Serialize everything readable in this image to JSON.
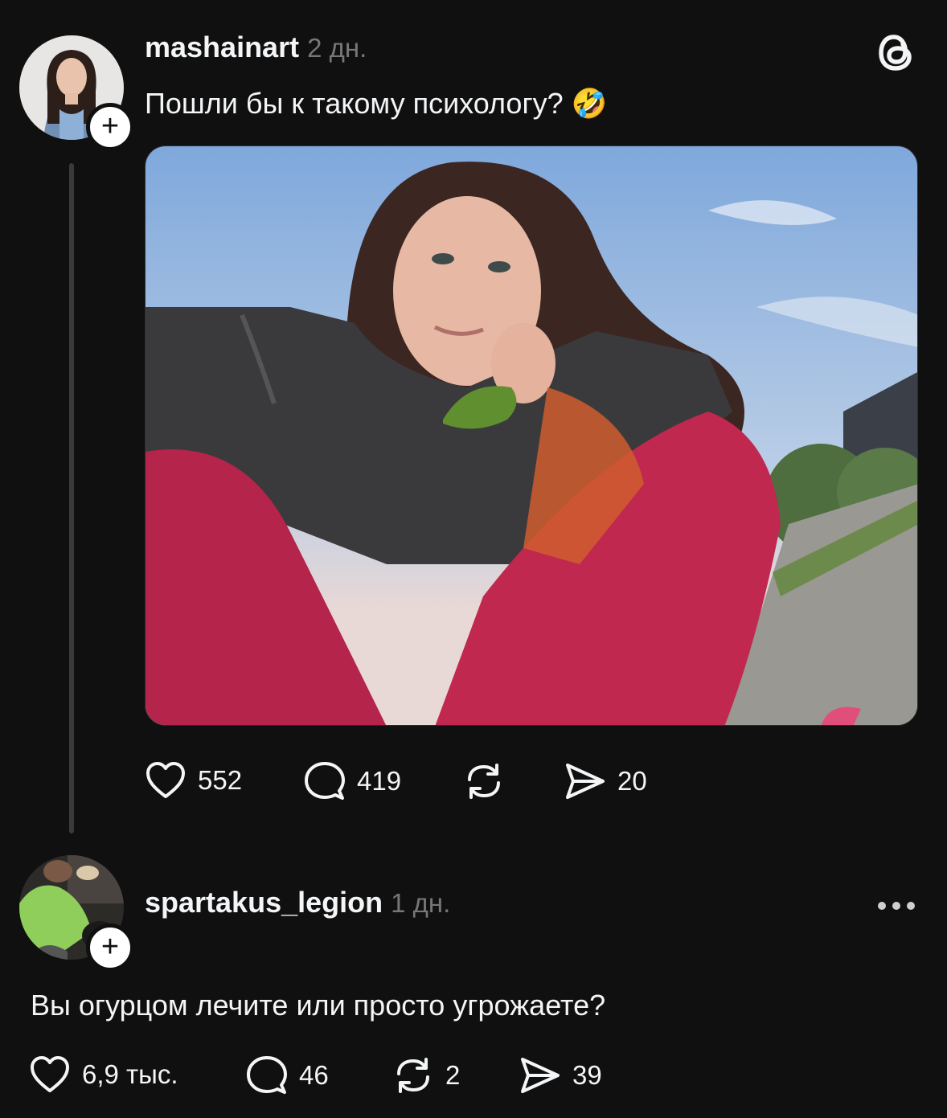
{
  "post": {
    "username": "mashainart",
    "time": "2 дн.",
    "text": "Пошли бы к такому психологу? 🤣",
    "actions": {
      "likes": "552",
      "replies": "419",
      "reposts": "",
      "shares": "20"
    }
  },
  "reply": {
    "username": "spartakus_legion",
    "time": "1 дн.",
    "text": "Вы огурцом лечите или просто угрожаете?",
    "actions": {
      "likes": "6,9 тыс.",
      "replies": "46",
      "reposts": "2",
      "shares": "39"
    }
  },
  "icons": {
    "app_logo": "threads-logo-icon",
    "follow": "plus-icon",
    "like": "heart-icon",
    "reply": "comment-icon",
    "repost": "repost-icon",
    "share": "send-icon",
    "more": "more-options-icon"
  },
  "colors": {
    "background": "#101010",
    "text": "#f3f5f7",
    "muted": "#777777",
    "thread_line": "#3a3a3a"
  }
}
